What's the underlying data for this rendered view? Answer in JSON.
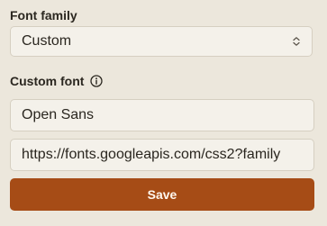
{
  "font_family": {
    "label": "Font family",
    "selected": "Custom"
  },
  "custom_font": {
    "label": "Custom font",
    "name_value": "Open Sans",
    "url_value": "https://fonts.googleapis.com/css2?family"
  },
  "actions": {
    "save_label": "Save"
  },
  "icons": {
    "info": "info-icon",
    "select_chevron": "chevron-up-down-icon"
  },
  "colors": {
    "background": "#ece7dc",
    "field_background": "#f4f1ea",
    "accent": "#a64c16"
  }
}
